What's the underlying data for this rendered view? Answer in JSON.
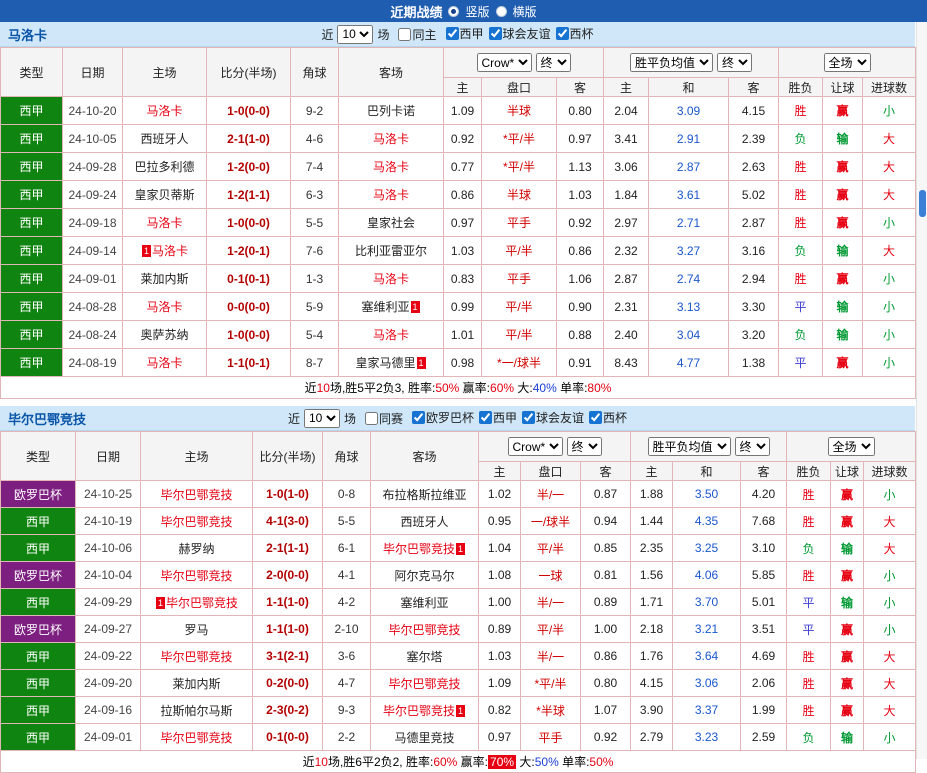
{
  "topbar": {
    "title": "近期战绩",
    "radios": [
      {
        "label": "竖版",
        "selected": true
      },
      {
        "label": "横版",
        "selected": false
      }
    ]
  },
  "labels": {
    "near": "近",
    "games": "场"
  },
  "table_header": {
    "cols": [
      "类型",
      "日期",
      "主场",
      "比分(半场)",
      "角球",
      "客场"
    ],
    "bookmaker": "Crow*",
    "final": "终",
    "avg": "胜平负均值",
    "scope": "全场",
    "sub": [
      "主",
      "盘口",
      "客",
      "主",
      "和",
      "客",
      "胜负",
      "让球",
      "进球数"
    ]
  },
  "maps": {
    "league_colors": {
      "西甲": "#108410",
      "欧罗巴杯": "#7d1f80"
    },
    "result_colors": {
      "胜": "#e60012",
      "平": "#3c3cd2",
      "负": "#009933"
    },
    "handicap_result_colors": {
      "赢": "#e60012",
      "输": "#009933"
    },
    "goal_colors": {
      "大": "#e60012",
      "小": "#009933"
    }
  },
  "sections": [
    {
      "team": "马洛卡",
      "filters": {
        "count": "10",
        "same": {
          "label": "同主",
          "checked": false
        },
        "leagues": [
          {
            "label": "西甲",
            "checked": true
          },
          {
            "label": "球会友谊",
            "checked": true
          },
          {
            "label": "西杯",
            "checked": true
          }
        ]
      },
      "rows": [
        {
          "league": "西甲",
          "date": "24-10-20",
          "home": {
            "name": "马洛卡",
            "focus": true
          },
          "score": "1-0(0-0)",
          "corner": "9-2",
          "away": {
            "name": "巴列卡诺"
          },
          "asia": [
            "1.09",
            "半球",
            "0.80"
          ],
          "europe": [
            "2.04",
            "3.09",
            "4.15"
          ],
          "res": "胜",
          "let": "赢",
          "goal": "小"
        },
        {
          "league": "西甲",
          "date": "24-10-05",
          "home": {
            "name": "西班牙人"
          },
          "score": "2-1(1-0)",
          "corner": "4-6",
          "away": {
            "name": "马洛卡",
            "focus": true
          },
          "asia": [
            "0.92",
            "*平/半",
            "0.97"
          ],
          "europe": [
            "3.41",
            "2.91",
            "2.39"
          ],
          "res": "负",
          "let": "输",
          "goal": "大"
        },
        {
          "league": "西甲",
          "date": "24-09-28",
          "home": {
            "name": "巴拉多利德"
          },
          "score": "1-2(0-0)",
          "corner": "7-4",
          "away": {
            "name": "马洛卡",
            "focus": true
          },
          "asia": [
            "0.77",
            "*平/半",
            "1.13"
          ],
          "europe": [
            "3.06",
            "2.87",
            "2.63"
          ],
          "res": "胜",
          "let": "赢",
          "goal": "大"
        },
        {
          "league": "西甲",
          "date": "24-09-24",
          "home": {
            "name": "皇家贝蒂斯"
          },
          "score": "1-2(1-1)",
          "corner": "6-3",
          "away": {
            "name": "马洛卡",
            "focus": true
          },
          "asia": [
            "0.86",
            "半球",
            "1.03"
          ],
          "europe": [
            "1.84",
            "3.61",
            "5.02"
          ],
          "res": "胜",
          "let": "赢",
          "goal": "大"
        },
        {
          "league": "西甲",
          "date": "24-09-18",
          "home": {
            "name": "马洛卡",
            "focus": true
          },
          "score": "1-0(0-0)",
          "corner": "5-5",
          "away": {
            "name": "皇家社会"
          },
          "asia": [
            "0.97",
            "平手",
            "0.92"
          ],
          "europe": [
            "2.97",
            "2.71",
            "2.87"
          ],
          "res": "胜",
          "let": "赢",
          "goal": "小"
        },
        {
          "league": "西甲",
          "date": "24-09-14",
          "home": {
            "name": "马洛卡",
            "focus": true,
            "badge": "1",
            "badge_side": "left"
          },
          "score": "1-2(0-1)",
          "corner": "7-6",
          "away": {
            "name": "比利亚雷亚尔"
          },
          "asia": [
            "1.03",
            "平/半",
            "0.86"
          ],
          "europe": [
            "2.32",
            "3.27",
            "3.16"
          ],
          "res": "负",
          "let": "输",
          "goal": "大"
        },
        {
          "league": "西甲",
          "date": "24-09-01",
          "home": {
            "name": "莱加内斯"
          },
          "score": "0-1(0-1)",
          "corner": "1-3",
          "away": {
            "name": "马洛卡",
            "focus": true
          },
          "asia": [
            "0.83",
            "平手",
            "1.06"
          ],
          "europe": [
            "2.87",
            "2.74",
            "2.94"
          ],
          "res": "胜",
          "let": "赢",
          "goal": "小"
        },
        {
          "league": "西甲",
          "date": "24-08-28",
          "home": {
            "name": "马洛卡",
            "focus": true
          },
          "score": "0-0(0-0)",
          "corner": "5-9",
          "away": {
            "name": "塞维利亚",
            "badge": "1",
            "badge_side": "right"
          },
          "asia": [
            "0.99",
            "平/半",
            "0.90"
          ],
          "europe": [
            "2.31",
            "3.13",
            "3.30"
          ],
          "res": "平",
          "let": "输",
          "goal": "小"
        },
        {
          "league": "西甲",
          "date": "24-08-24",
          "home": {
            "name": "奥萨苏纳"
          },
          "score": "1-0(0-0)",
          "corner": "5-4",
          "away": {
            "name": "马洛卡",
            "focus": true
          },
          "asia": [
            "1.01",
            "平/半",
            "0.88"
          ],
          "europe": [
            "2.40",
            "3.04",
            "3.20"
          ],
          "res": "负",
          "let": "输",
          "goal": "小"
        },
        {
          "league": "西甲",
          "date": "24-08-19",
          "home": {
            "name": "马洛卡",
            "focus": true
          },
          "score": "1-1(0-1)",
          "corner": "8-7",
          "away": {
            "name": "皇家马德里",
            "badge": "1",
            "badge_side": "right"
          },
          "asia": [
            "0.98",
            "*一/球半",
            "0.91"
          ],
          "europe": [
            "8.43",
            "4.77",
            "1.38"
          ],
          "res": "平",
          "let": "赢",
          "goal": "小"
        }
      ],
      "summary": [
        {
          "t": "近",
          "c": "k"
        },
        {
          "t": "10",
          "c": "r"
        },
        {
          "t": "场,胜5平2负3, 胜率:",
          "c": "k"
        },
        {
          "t": "50%",
          "c": "r"
        },
        {
          "t": " 赢率:",
          "c": "k"
        },
        {
          "t": "60%",
          "c": "r"
        },
        {
          "t": " 大:",
          "c": "k"
        },
        {
          "t": "40%",
          "c": "b"
        },
        {
          "t": " 单率:",
          "c": "k"
        },
        {
          "t": "80%",
          "c": "r"
        }
      ]
    },
    {
      "team": "毕尔巴鄂竞技",
      "filters": {
        "count": "10",
        "same": {
          "label": "同赛",
          "checked": false
        },
        "leagues": [
          {
            "label": "欧罗巴杯",
            "checked": true
          },
          {
            "label": "西甲",
            "checked": true
          },
          {
            "label": "球会友谊",
            "checked": true
          },
          {
            "label": "西杯",
            "checked": true
          }
        ]
      },
      "rows": [
        {
          "league": "欧罗巴杯",
          "date": "24-10-25",
          "home": {
            "name": "毕尔巴鄂竞技",
            "focus": true
          },
          "score": "1-0(1-0)",
          "corner": "0-8",
          "away": {
            "name": "布拉格斯拉维亚"
          },
          "asia": [
            "1.02",
            "半/一",
            "0.87"
          ],
          "europe": [
            "1.88",
            "3.50",
            "4.20"
          ],
          "res": "胜",
          "let": "赢",
          "goal": "小"
        },
        {
          "league": "西甲",
          "date": "24-10-19",
          "home": {
            "name": "毕尔巴鄂竞技",
            "focus": true
          },
          "score": "4-1(3-0)",
          "corner": "5-5",
          "away": {
            "name": "西班牙人"
          },
          "asia": [
            "0.95",
            "一/球半",
            "0.94"
          ],
          "europe": [
            "1.44",
            "4.35",
            "7.68"
          ],
          "res": "胜",
          "let": "赢",
          "goal": "大"
        },
        {
          "league": "西甲",
          "date": "24-10-06",
          "home": {
            "name": "赫罗纳"
          },
          "score": "2-1(1-1)",
          "corner": "6-1",
          "away": {
            "name": "毕尔巴鄂竞技",
            "focus": true,
            "badge": "1",
            "badge_side": "right"
          },
          "asia": [
            "1.04",
            "平/半",
            "0.85"
          ],
          "europe": [
            "2.35",
            "3.25",
            "3.10"
          ],
          "res": "负",
          "let": "输",
          "goal": "大"
        },
        {
          "league": "欧罗巴杯",
          "date": "24-10-04",
          "home": {
            "name": "毕尔巴鄂竞技",
            "focus": true
          },
          "score": "2-0(0-0)",
          "corner": "4-1",
          "away": {
            "name": "阿尔克马尔"
          },
          "asia": [
            "1.08",
            "一球",
            "0.81"
          ],
          "europe": [
            "1.56",
            "4.06",
            "5.85"
          ],
          "res": "胜",
          "let": "赢",
          "goal": "小"
        },
        {
          "league": "西甲",
          "date": "24-09-29",
          "home": {
            "name": "毕尔巴鄂竞技",
            "focus": true,
            "badge": "1",
            "badge_side": "left"
          },
          "score": "1-1(1-0)",
          "corner": "4-2",
          "away": {
            "name": "塞维利亚"
          },
          "asia": [
            "1.00",
            "半/一",
            "0.89"
          ],
          "europe": [
            "1.71",
            "3.70",
            "5.01"
          ],
          "res": "平",
          "let": "输",
          "goal": "小"
        },
        {
          "league": "欧罗巴杯",
          "date": "24-09-27",
          "home": {
            "name": "罗马"
          },
          "score": "1-1(1-0)",
          "corner": "2-10",
          "away": {
            "name": "毕尔巴鄂竞技",
            "focus": true
          },
          "asia": [
            "0.89",
            "平/半",
            "1.00"
          ],
          "europe": [
            "2.18",
            "3.21",
            "3.51"
          ],
          "res": "平",
          "let": "赢",
          "goal": "小"
        },
        {
          "league": "西甲",
          "date": "24-09-22",
          "home": {
            "name": "毕尔巴鄂竞技",
            "focus": true
          },
          "score": "3-1(2-1)",
          "corner": "3-6",
          "away": {
            "name": "塞尔塔"
          },
          "asia": [
            "1.03",
            "半/一",
            "0.86"
          ],
          "europe": [
            "1.76",
            "3.64",
            "4.69"
          ],
          "res": "胜",
          "let": "赢",
          "goal": "大"
        },
        {
          "league": "西甲",
          "date": "24-09-20",
          "home": {
            "name": "莱加内斯"
          },
          "score": "0-2(0-0)",
          "corner": "4-7",
          "away": {
            "name": "毕尔巴鄂竞技",
            "focus": true
          },
          "asia": [
            "1.09",
            "*平/半",
            "0.80"
          ],
          "europe": [
            "4.15",
            "3.06",
            "2.06"
          ],
          "res": "胜",
          "let": "赢",
          "goal": "大"
        },
        {
          "league": "西甲",
          "date": "24-09-16",
          "home": {
            "name": "拉斯帕尔马斯"
          },
          "score": "2-3(0-2)",
          "corner": "9-3",
          "away": {
            "name": "毕尔巴鄂竞技",
            "focus": true,
            "badge": "1",
            "badge_side": "right"
          },
          "asia": [
            "0.82",
            "*半球",
            "1.07"
          ],
          "europe": [
            "3.90",
            "3.37",
            "1.99"
          ],
          "res": "胜",
          "let": "赢",
          "goal": "大"
        },
        {
          "league": "西甲",
          "date": "24-09-01",
          "home": {
            "name": "毕尔巴鄂竞技",
            "focus": true
          },
          "score": "0-1(0-0)",
          "corner": "2-2",
          "away": {
            "name": "马德里竞技"
          },
          "asia": [
            "0.97",
            "平手",
            "0.92"
          ],
          "europe": [
            "2.79",
            "3.23",
            "2.59"
          ],
          "res": "负",
          "let": "输",
          "goal": "小"
        }
      ],
      "summary": [
        {
          "t": "近",
          "c": "k"
        },
        {
          "t": "10",
          "c": "r"
        },
        {
          "t": "场,胜6平2负2, 胜率:",
          "c": "k"
        },
        {
          "t": "60%",
          "c": "r"
        },
        {
          "t": " 赢率:",
          "c": "k"
        },
        {
          "t": "70%",
          "c": "hl"
        },
        {
          "t": " 大:",
          "c": "k"
        },
        {
          "t": "50%",
          "c": "b"
        },
        {
          "t": " 单率:",
          "c": "k"
        },
        {
          "t": "50%",
          "c": "r"
        }
      ]
    }
  ]
}
